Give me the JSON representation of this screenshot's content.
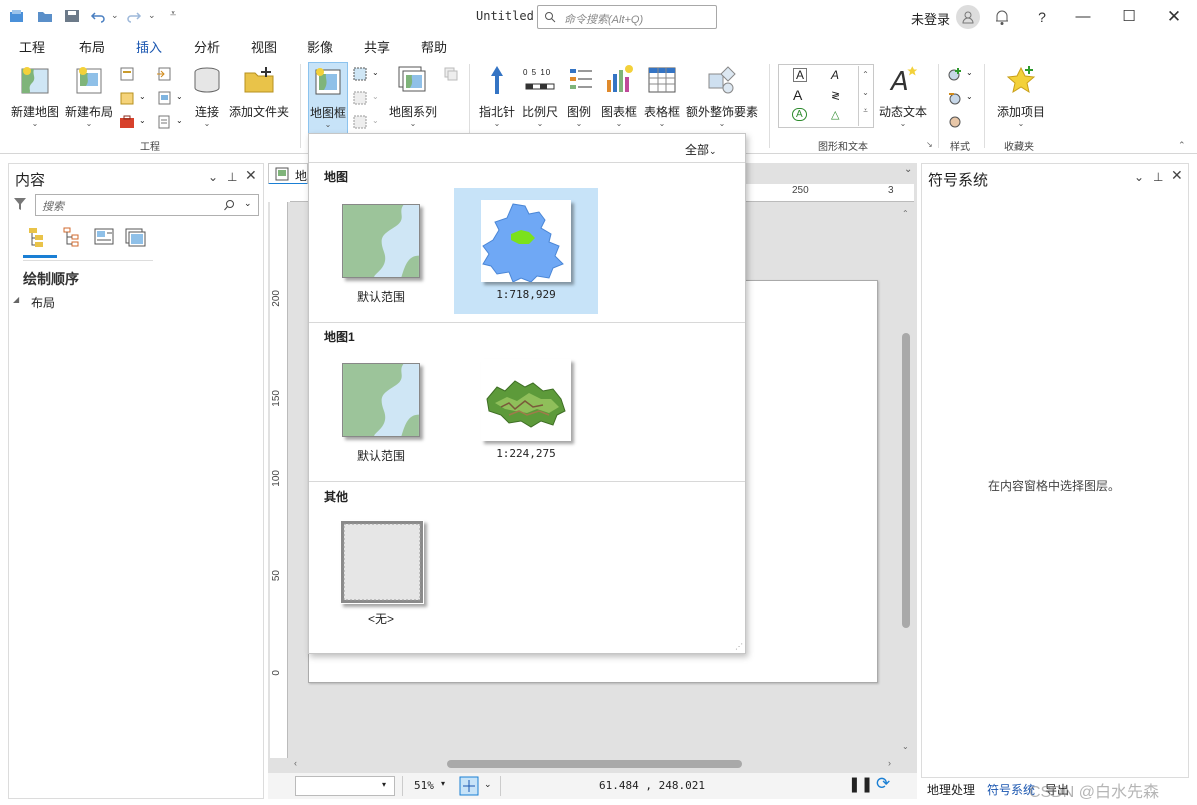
{
  "window": {
    "doc_title": "Untitled",
    "command_search_placeholder": "命令搜索(Alt+Q)",
    "user_status": "未登录"
  },
  "ribbon_tabs": [
    "工程",
    "布局",
    "插入",
    "分析",
    "视图",
    "影像",
    "共享",
    "帮助"
  ],
  "active_tab": "插入",
  "ribbon": {
    "project_group": {
      "new_map": "新建地图",
      "new_layout": "新建布局",
      "connect": "连接",
      "add_folder": "添加文件夹",
      "group_label": "工程"
    },
    "map_frame": "地图框",
    "map_series": "地图系列",
    "north_arrow": "指北针",
    "scale_bar": "比例尺",
    "legend": "图例",
    "chart_frame": "图表框",
    "table_frame": "表格框",
    "extra_elements": "额外整饰要素",
    "dynamic_text": "动态文本",
    "graphics_group_label": "图形和文本",
    "styles_group_label": "样式",
    "add_item": "添加项目",
    "favorites_group_label": "收藏夹",
    "scale_bar_ticks": "0 5 10"
  },
  "contents_pane": {
    "title": "内容",
    "search_placeholder": "搜索",
    "drawing_order": "绘制顺序",
    "tree_item": "布局"
  },
  "layout_view": {
    "tab_label": "地",
    "ruler_h_labels": [
      "250",
      "3"
    ],
    "ruler_v_labels": [
      "200",
      "150",
      "100",
      "50",
      "0"
    ],
    "zoom": "51%",
    "coordinates": "61.484 , 248.021"
  },
  "symbology_pane": {
    "title": "符号系统",
    "message": "在内容窗格中选择图层。"
  },
  "bottom_tabs": [
    "地理处理",
    "符号系统",
    "导出"
  ],
  "watermark": "CSDN @白水先森",
  "gallery": {
    "filter": "全部",
    "sections": [
      {
        "title": "地图",
        "items": [
          {
            "label": "默认范围"
          },
          {
            "label": "1:718,929"
          }
        ]
      },
      {
        "title": "地图1",
        "items": [
          {
            "label": "默认范围"
          },
          {
            "label": "1:224,275"
          }
        ]
      },
      {
        "title": "其他",
        "items": [
          {
            "label": "<无>"
          }
        ]
      }
    ]
  },
  "colors": {
    "accent": "#1a7fd4",
    "selected_item": "#c7e3f8",
    "map_blue": "#6fa8f5",
    "map_green": "#7be11c"
  }
}
